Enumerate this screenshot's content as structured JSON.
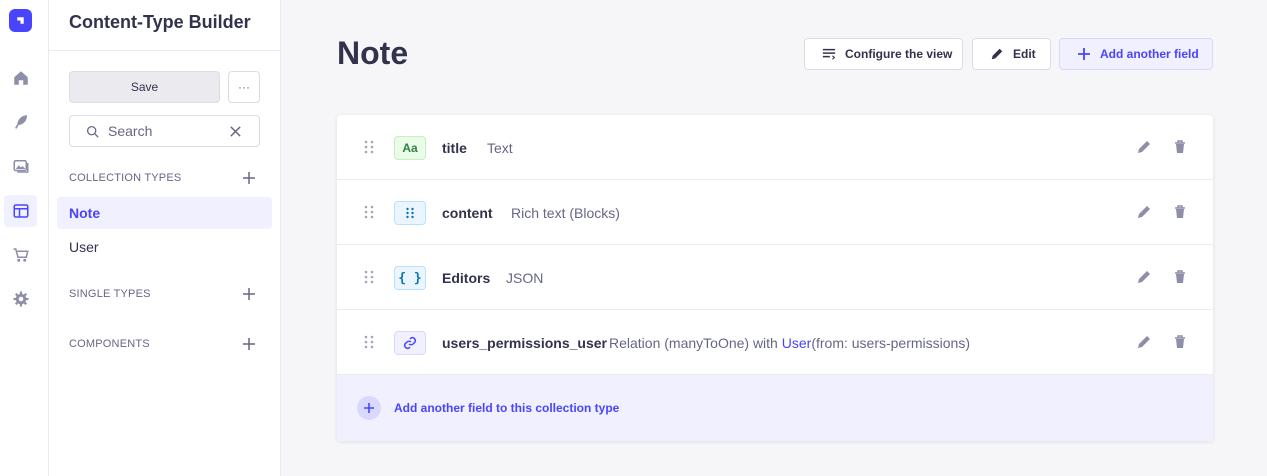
{
  "rail": {
    "items": [
      {
        "icon": "home-icon"
      },
      {
        "icon": "feather-icon"
      },
      {
        "icon": "media-library-icon"
      },
      {
        "icon": "content-type-builder-icon"
      },
      {
        "icon": "cart-icon"
      },
      {
        "icon": "settings-gear-icon"
      }
    ],
    "active_index": 3
  },
  "sidebar": {
    "title": "Content-Type Builder",
    "save_label": "Save",
    "more_label": "···",
    "search_placeholder": "Search",
    "sections": {
      "collection_types": {
        "label": "COLLECTION TYPES",
        "items": [
          {
            "label": "Note",
            "active": true
          },
          {
            "label": "User",
            "active": false
          }
        ]
      },
      "single_types": {
        "label": "SINGLE TYPES"
      },
      "components": {
        "label": "COMPONENTS"
      }
    }
  },
  "main": {
    "title": "Note",
    "buttons": {
      "configure": "Configure the view",
      "edit": "Edit",
      "add_field": "Add another field"
    },
    "fields": [
      {
        "name": "title",
        "type": "Text",
        "icon_glyph": "Aa",
        "icon_name": "text-field-icon"
      },
      {
        "name": "content",
        "type": "Rich text (Blocks)",
        "icon_name": "blocks-field-icon"
      },
      {
        "name": "Editors",
        "type": "JSON",
        "icon_glyph": "{ }",
        "icon_name": "json-field-icon"
      },
      {
        "name": "users_permissions_user",
        "type_prefix": "Relation (manyToOne) with ",
        "type_link": "User",
        "type_suffix": "(from: users-permissions)",
        "icon_name": "relation-field-icon"
      }
    ],
    "add_row_label": "Add another field to this collection type"
  },
  "colors": {
    "primary": "#4945ff",
    "primary_light": "#f0f0ff",
    "text": "#32324d",
    "muted": "#666687",
    "border": "#dcdce4",
    "text_field_bg": "#eafbe7",
    "text_field_fg": "#328048",
    "blocks_field_bg": "#eaf5ff",
    "blocks_field_fg": "#0c75af"
  }
}
